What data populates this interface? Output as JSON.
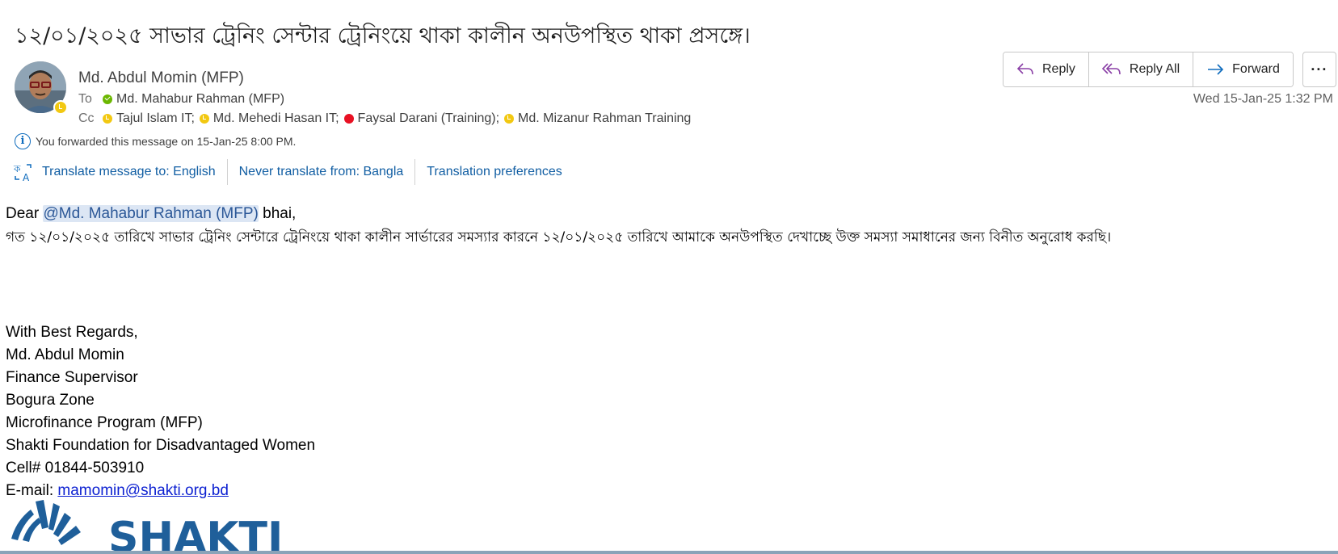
{
  "email": {
    "subject": "১২/০১/২০২৫ সাভার ট্রেনিং সেন্টার ট্রেনিংয়ে থাকা কালীন অনউপস্থিত থাকা প্রসঙ্গে।",
    "sender": "Md. Abdul Momin (MFP)",
    "to_label": "To",
    "to": [
      {
        "name": "Md. Mahabur Rahman (MFP)",
        "status": "available",
        "color": "#6bb700"
      }
    ],
    "cc_label": "Cc",
    "cc": [
      {
        "name": "Tajul Islam IT;",
        "status": "away",
        "color": "#f2c811"
      },
      {
        "name": "Md. Mehedi Hasan IT;",
        "status": "away",
        "color": "#f2c811"
      },
      {
        "name": "Faysal Darani (Training);",
        "status": "busy",
        "color": "#e81123"
      },
      {
        "name": "Md. Mizanur Rahman Training",
        "status": "away",
        "color": "#f2c811"
      }
    ],
    "timestamp": "Wed 15-Jan-25 1:32 PM",
    "forward_note": "You forwarded this message on 15-Jan-25 8:00 PM."
  },
  "translate": {
    "translate_to": "Translate message to: English",
    "never_translate": "Never translate from: Bangla",
    "preferences": "Translation preferences"
  },
  "actions": {
    "reply": "Reply",
    "reply_all": "Reply All",
    "forward": "Forward",
    "more": "···"
  },
  "body": {
    "greeting_prefix": "Dear ",
    "mention": "@Md. Mahabur Rahman (MFP)",
    "greeting_suffix": " bhai,",
    "paragraph": "গত ১২/০১/২০২৫ তারিখে সাভার ট্রেনিং সেন্টারে ট্রেনিংয়ে থাকা কালীন সার্ভারের সমস্যার কারনে ১২/০১/২০২৫ তারিখে আমাকে অনউপস্থিত দেখাচ্ছে উক্ত সমস্যা সমাধানের জন্য বিনীত অনুরোধ করছি।"
  },
  "signature": {
    "closing": "With Best Regards,",
    "name": "Md. Abdul Momin",
    "title": "Finance Supervisor",
    "zone": "Bogura Zone",
    "program": "Microfinance Program (MFP)",
    "org": "Shakti Foundation for Disadvantaged Women",
    "cell": "Cell# 01844-503910",
    "email_label": "E-mail: ",
    "email": "mamomin@shakti.org.bd",
    "logo_text": "SHAKTI"
  },
  "colors": {
    "link": "#115ea3",
    "mention_bg": "#dce6f4",
    "brand": "#1f5f9a"
  }
}
